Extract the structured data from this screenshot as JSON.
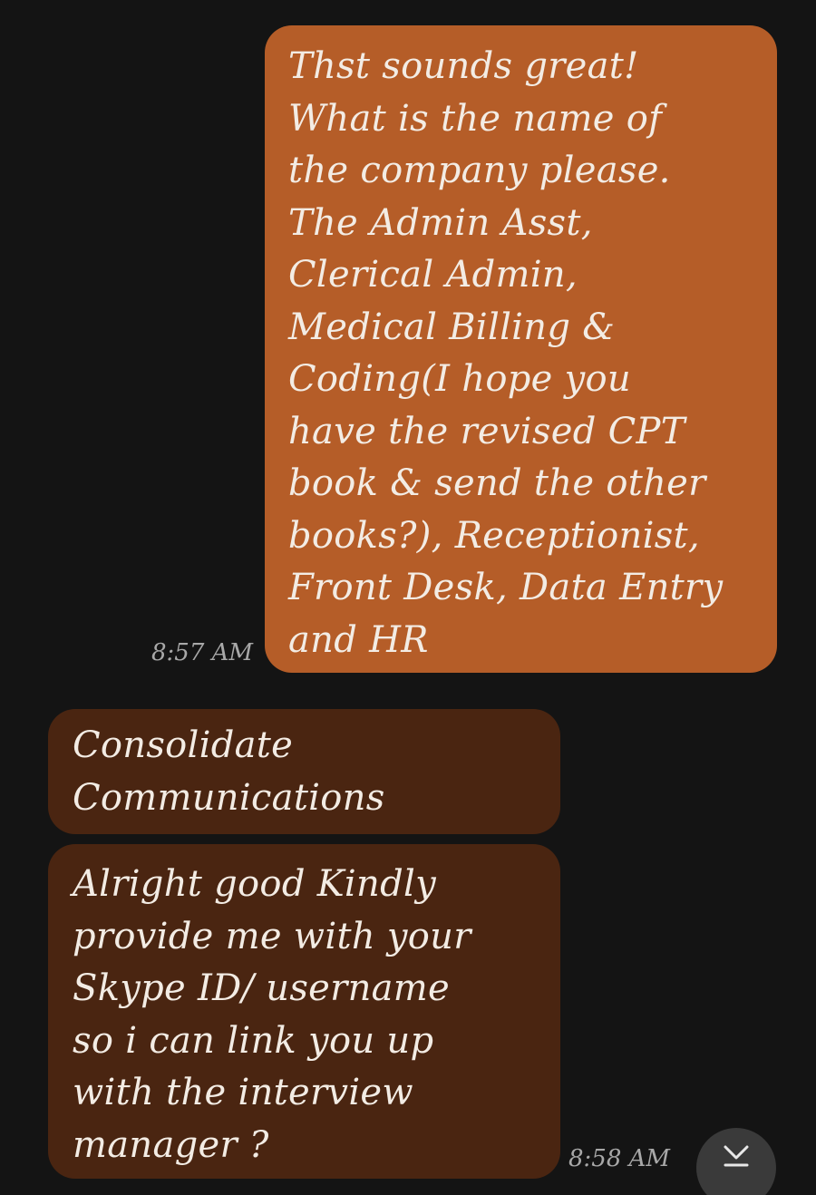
{
  "conversation": {
    "messages": [
      {
        "direction": "outgoing",
        "text": "Thst sounds great!\nWhat is the name of\nthe company please.\nThe Admin Asst,\nClerical Admin,\nMedical Billing &\nCoding(I hope you\nhave the revised CPT\nbook & send the other\nbooks?), Receptionist,\nFront Desk, Data Entry\nand HR",
        "time": "8:57 AM"
      },
      {
        "direction": "incoming",
        "text": "Consolidate\nCommunications"
      },
      {
        "direction": "incoming",
        "text": "Alright good Kindly\nprovide me with your\nSkype ID/ username\nso i can link you up\nwith the interview\nmanager ?",
        "time": "8:58 AM"
      }
    ]
  },
  "controls": {
    "scroll_to_bottom_icon": "chevron-down-icon"
  },
  "colors": {
    "background": "#141414",
    "outgoing_bubble": "#b55d28",
    "incoming_bubble": "#4a2511",
    "text": "#f3ece4",
    "timestamp": "#a8a8a8",
    "scroll_button": "#3a3a3a"
  }
}
